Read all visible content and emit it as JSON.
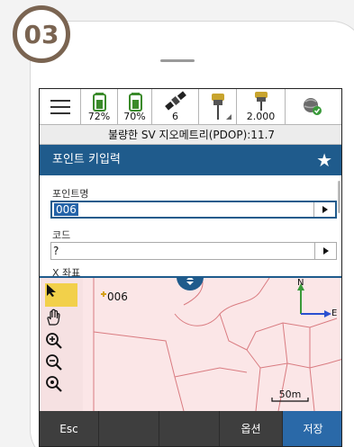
{
  "step": {
    "number": "03"
  },
  "status_bar": {
    "battery1": "72%",
    "battery2": "70%",
    "satellites": "6",
    "antenna_height": "2.000"
  },
  "info_line": "불량한 SV 지오메트리(PDOP):11.7",
  "form": {
    "title": "포인트 키입력",
    "point_name_label": "포인트명",
    "point_name_value": "006",
    "code_label": "코드",
    "code_value": "?",
    "x_label": "X 좌표"
  },
  "map": {
    "point_label": "006",
    "north_label": "N",
    "east_label": "E",
    "scale_label": "50m"
  },
  "bottom_bar": {
    "esc": "Esc",
    "options": "옵션",
    "save": "저장"
  },
  "colors": {
    "header_blue": "#1f5b8c",
    "save_blue": "#2a69a8",
    "map_bg": "#fbe6e7",
    "badge_brown": "#7a6451"
  }
}
